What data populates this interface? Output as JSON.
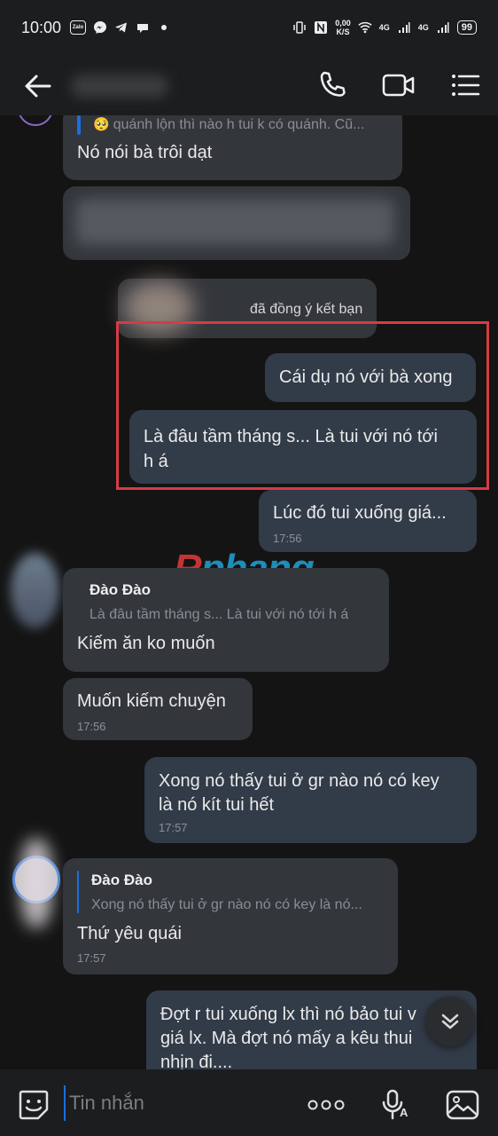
{
  "status_bar": {
    "time": "10:00",
    "net_speed_value": "0,00",
    "net_speed_unit": "K/S",
    "signal1": "4G",
    "signal2": "4G",
    "battery": "99",
    "zalo_label": "Zalo"
  },
  "header": {
    "icons": [
      "back-arrow-icon",
      "phone-icon",
      "video-call-icon",
      "list-menu-icon"
    ]
  },
  "messages": [
    {
      "id": "m1",
      "direction": "in",
      "quote_text": "quánh lộn thì nào h tui k có quánh. Cũ...",
      "quote_emoji": "🥺",
      "text": "Nó nói bà trôi dạt"
    },
    {
      "id": "m3",
      "type": "system",
      "text": "đã đồng ý kết bạn"
    },
    {
      "id": "m4",
      "direction": "out",
      "text": "Cái dụ nó với bà xong"
    },
    {
      "id": "m5",
      "direction": "out",
      "text_line1": "Là đâu tầm tháng s... Là tui với nó tới",
      "text_line2": "h á"
    },
    {
      "id": "m6",
      "direction": "out",
      "text": "Lúc đó tui xuống giá...",
      "time": "17:56"
    },
    {
      "id": "m7",
      "direction": "in",
      "quote_name": "Đào Đào",
      "quote_text": "Là đâu tầm tháng s... Là tui với nó tới h á",
      "text": "Kiếm ăn ko muốn"
    },
    {
      "id": "m8",
      "direction": "in",
      "text": "Muốn kiếm chuyện",
      "time": "17:56"
    },
    {
      "id": "m9",
      "direction": "out",
      "text_line1": "Xong nó thấy tui ở gr nào nó có key",
      "text_line2": "là nó kít tui hết",
      "time": "17:57"
    },
    {
      "id": "m10",
      "direction": "in",
      "quote_name": "Đào Đào",
      "quote_text": "Xong nó thấy tui ở gr nào nó có key là nó...",
      "text": "Thứ yêu quái",
      "time": "17:57"
    },
    {
      "id": "m11",
      "direction": "out",
      "text_line1": "Đợt r tui xuống lx thì nó bảo tui v",
      "text_line2": "giá lx. Mà đợt nó mấy a kêu thui",
      "text_line3": "nhịn đi...."
    }
  ],
  "watermark": {
    "part1": "R",
    "part2": "phang"
  },
  "composer": {
    "placeholder": "Tin nhắn",
    "icons": [
      "sticker-icon",
      "more-options-icon",
      "voice-text-icon",
      "image-icon"
    ]
  },
  "colors": {
    "accent": "#1a6fe0",
    "highlight_border": "#d93a44",
    "bubble_in": "#33363b",
    "bubble_out": "#323b48",
    "background": "#141414"
  }
}
